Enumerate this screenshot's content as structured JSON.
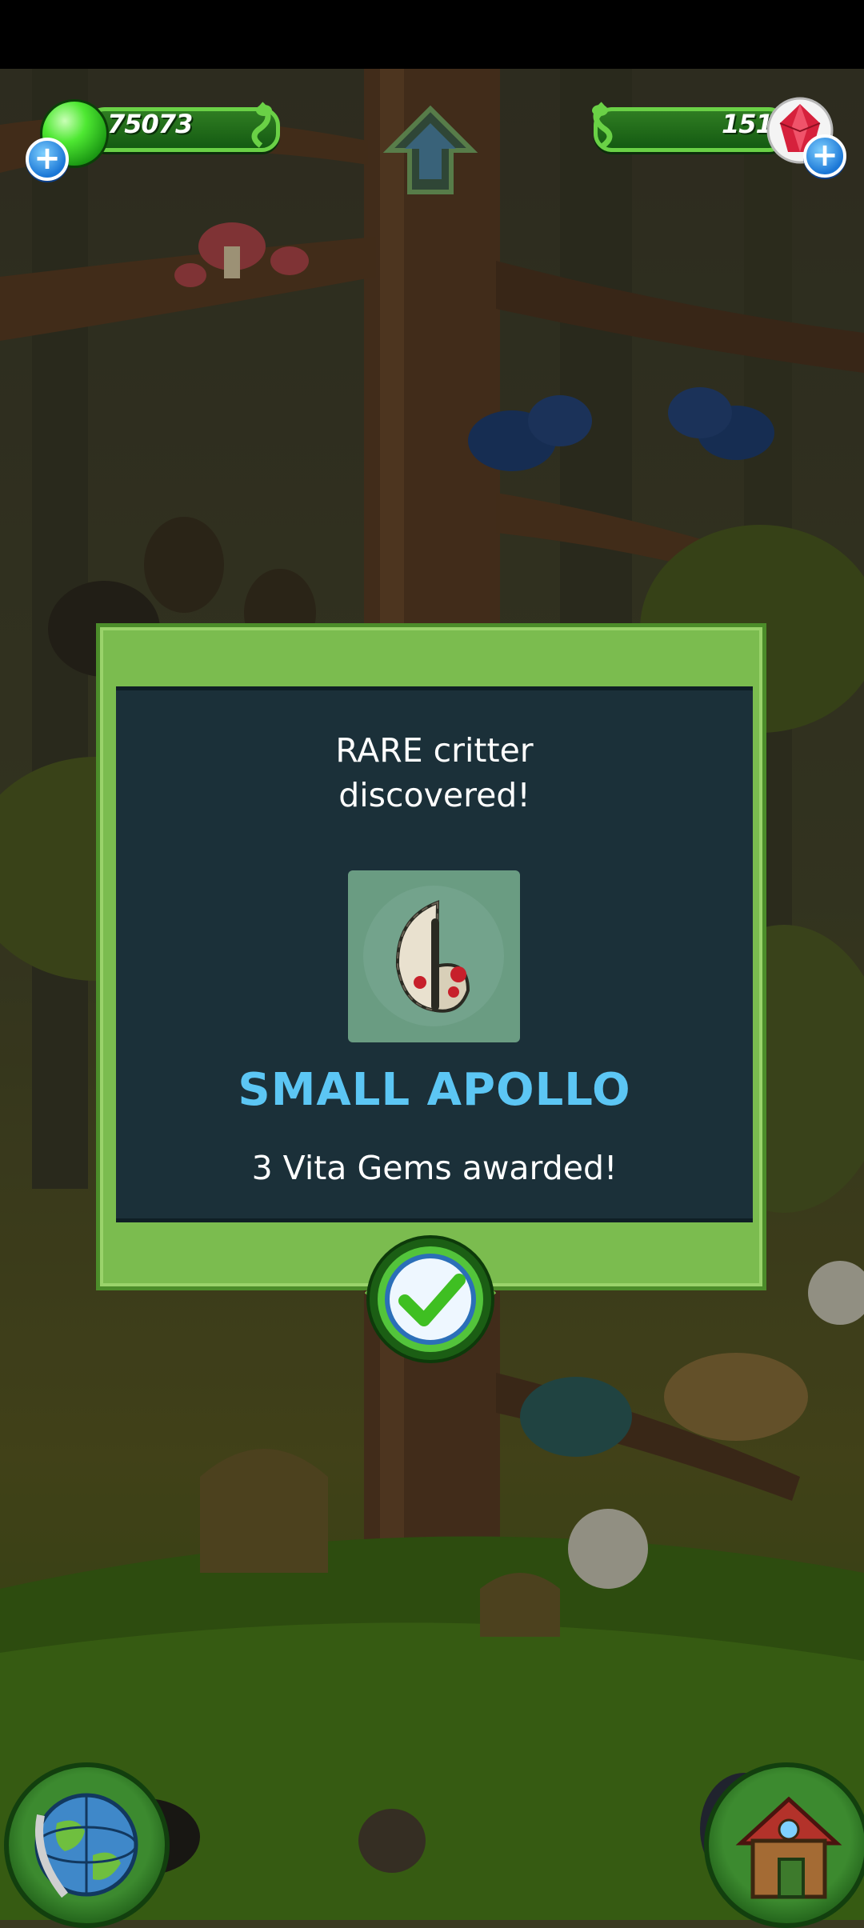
{
  "hud": {
    "vita_jelly_count": "75073",
    "vita_gems_count": "151"
  },
  "dialog": {
    "title": "RARE critter\ndiscovered!",
    "critter_name": "SMALL APOLLO",
    "reward": "3 Vita Gems awarded!"
  },
  "colors": {
    "panel_bg": "#1b3039",
    "frame_green": "#7bbc4f",
    "critter_name": "#5cc6f4"
  },
  "icons": {
    "jelly": "vita-jelly-icon",
    "gem": "vita-gem-icon",
    "plus": "plus-icon",
    "home": "home-arrow-icon",
    "confirm": "checkmark-icon",
    "globe": "globe-icon",
    "house": "house-icon",
    "critter": "small-apollo-butterfly-icon"
  }
}
